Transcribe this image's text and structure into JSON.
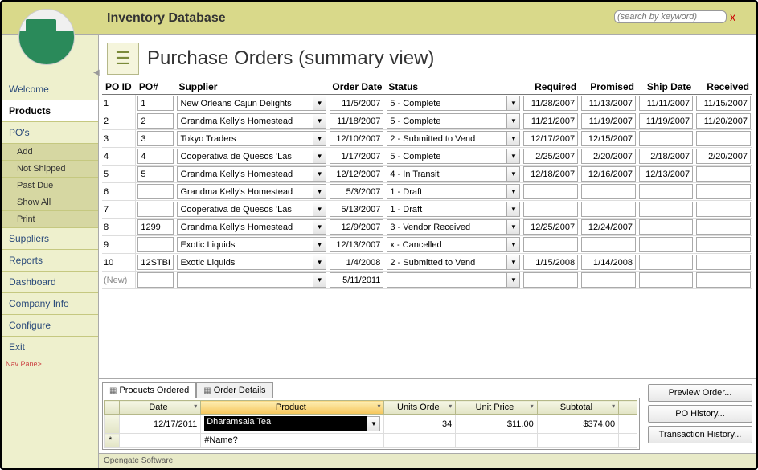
{
  "app_title": "Inventory Database",
  "search": {
    "placeholder": "(search by keyword)"
  },
  "view_title": "Purchase Orders (summary view)",
  "sidebar": {
    "items": [
      {
        "label": "Welcome",
        "active": false
      },
      {
        "label": "Products",
        "active": true
      },
      {
        "label": "PO's",
        "active": false,
        "sub": [
          {
            "label": "Add"
          },
          {
            "label": "Not Shipped"
          },
          {
            "label": "Past Due"
          },
          {
            "label": "Show All"
          },
          {
            "label": "Print"
          }
        ]
      },
      {
        "label": "Suppliers",
        "active": false
      },
      {
        "label": "Reports",
        "active": false
      },
      {
        "label": "Dashboard",
        "active": false
      },
      {
        "label": "Company Info",
        "active": false
      },
      {
        "label": "Configure",
        "active": false
      },
      {
        "label": "Exit",
        "active": false
      }
    ],
    "nav_pane": "Nav Pane>"
  },
  "columns": [
    "PO ID",
    "PO#",
    "Supplier",
    "Order Date",
    "Status",
    "Required",
    "Promised",
    "Ship Date",
    "Received"
  ],
  "rows": [
    {
      "id": "1",
      "po": "1",
      "supplier": "New Orleans Cajun Delights",
      "order": "11/5/2007",
      "status": "5 - Complete",
      "required": "11/28/2007",
      "promised": "11/13/2007",
      "ship": "11/11/2007",
      "received": "11/15/2007"
    },
    {
      "id": "2",
      "po": "2",
      "supplier": "Grandma Kelly's Homestead",
      "order": "11/18/2007",
      "status": "5 - Complete",
      "required": "11/21/2007",
      "promised": "11/19/2007",
      "ship": "11/19/2007",
      "received": "11/20/2007"
    },
    {
      "id": "3",
      "po": "3",
      "supplier": "Tokyo Traders",
      "order": "12/10/2007",
      "status": "2 - Submitted to Vend",
      "required": "12/17/2007",
      "promised": "12/15/2007",
      "ship": "",
      "received": ""
    },
    {
      "id": "4",
      "po": "4",
      "supplier": "Cooperativa de Quesos 'Las",
      "order": "1/17/2007",
      "status": "5 - Complete",
      "required": "2/25/2007",
      "promised": "2/20/2007",
      "ship": "2/18/2007",
      "received": "2/20/2007"
    },
    {
      "id": "5",
      "po": "5",
      "supplier": "Grandma Kelly's Homestead",
      "order": "12/12/2007",
      "status": "4 - In Transit",
      "required": "12/18/2007",
      "promised": "12/16/2007",
      "ship": "12/13/2007",
      "received": ""
    },
    {
      "id": "6",
      "po": "",
      "supplier": "Grandma Kelly's Homestead",
      "order": "5/3/2007",
      "status": "1 - Draft",
      "required": "",
      "promised": "",
      "ship": "",
      "received": ""
    },
    {
      "id": "7",
      "po": "",
      "supplier": "Cooperativa de Quesos 'Las",
      "order": "5/13/2007",
      "status": "1 - Draft",
      "required": "",
      "promised": "",
      "ship": "",
      "received": ""
    },
    {
      "id": "8",
      "po": "1299",
      "supplier": "Grandma Kelly's Homestead",
      "order": "12/9/2007",
      "status": "3 - Vendor Received",
      "required": "12/25/2007",
      "promised": "12/24/2007",
      "ship": "",
      "received": ""
    },
    {
      "id": "9",
      "po": "",
      "supplier": "Exotic Liquids",
      "order": "12/13/2007",
      "status": "x - Cancelled",
      "required": "",
      "promised": "",
      "ship": "",
      "received": ""
    },
    {
      "id": "10",
      "po": "12STBK",
      "supplier": "Exotic Liquids",
      "order": "1/4/2008",
      "status": "2 - Submitted to Vend",
      "required": "1/15/2008",
      "promised": "1/14/2008",
      "ship": "",
      "received": ""
    }
  ],
  "new_row": {
    "label": "(New)",
    "order": "5/11/2011"
  },
  "tabs": [
    {
      "label": "Products Ordered",
      "active": true
    },
    {
      "label": "Order Details",
      "active": false
    }
  ],
  "sub_columns": [
    "",
    "Date",
    "Product",
    "Units Orde",
    "Unit Price",
    "Subtotal",
    ""
  ],
  "sub_rows": [
    {
      "date": "12/17/2011",
      "product": "Dharamsala Tea",
      "units": "34",
      "price": "$11.00",
      "subtotal": "$374.00"
    },
    {
      "date": "",
      "product": "#Name?",
      "units": "",
      "price": "",
      "subtotal": ""
    }
  ],
  "buttons": {
    "preview": "Preview Order...",
    "history": "PO History...",
    "trans": "Transaction History..."
  },
  "footer": "Opengate Software"
}
